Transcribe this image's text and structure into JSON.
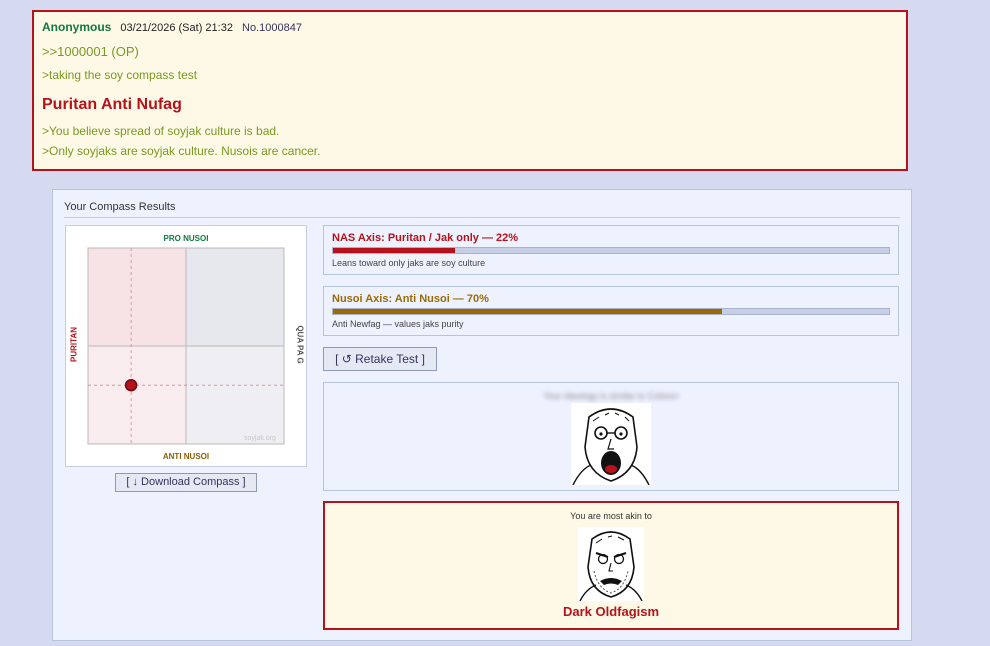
{
  "post": {
    "name": "Anonymous",
    "date": "03/21/2026 (Sat) 21:32",
    "number": "No.1000847",
    "quotelink": ">>1000001 (OP)",
    "line1": ">taking the soy compass test",
    "title": "Puritan Anti Nufag",
    "line2": ">You believe spread of soyjak culture is bad.",
    "line3": ">Only soyjaks are soyjak culture. Nusois are cancer."
  },
  "results": {
    "title": "Your Compass Results",
    "compass": {
      "top_label": "PRO NUSOI",
      "bottom_label": "ANTI NUSOI",
      "left_label": "PURITAN",
      "right_label": "QUA PA G",
      "watermark": "soyjak.org",
      "point_nas_percent": 22,
      "point_nusoi_percent": 70,
      "colors": {
        "puritan": "#b5121b",
        "pro": "#117743",
        "anti": "#8b5e06",
        "point": "#b5121b"
      }
    },
    "download_label": "[ ↓ Download Compass ]",
    "nas_axis": {
      "label": "NAS Axis: Puritan / Jak only — 22%",
      "percent": 22,
      "description": "Leans toward only jaks are soy culture"
    },
    "nusoi_axis": {
      "label": "Nusoi Axis: Anti Nusoi — 70%",
      "percent": 70,
      "description": "Anti Newfag — values jaks purity"
    },
    "retake_label": "[ ↺ Retake Test ]",
    "ideology_blurred": "Your ideology is similar to Cobson",
    "akin_label": "You are most akin to",
    "akin_result": "Dark Oldfagism"
  }
}
